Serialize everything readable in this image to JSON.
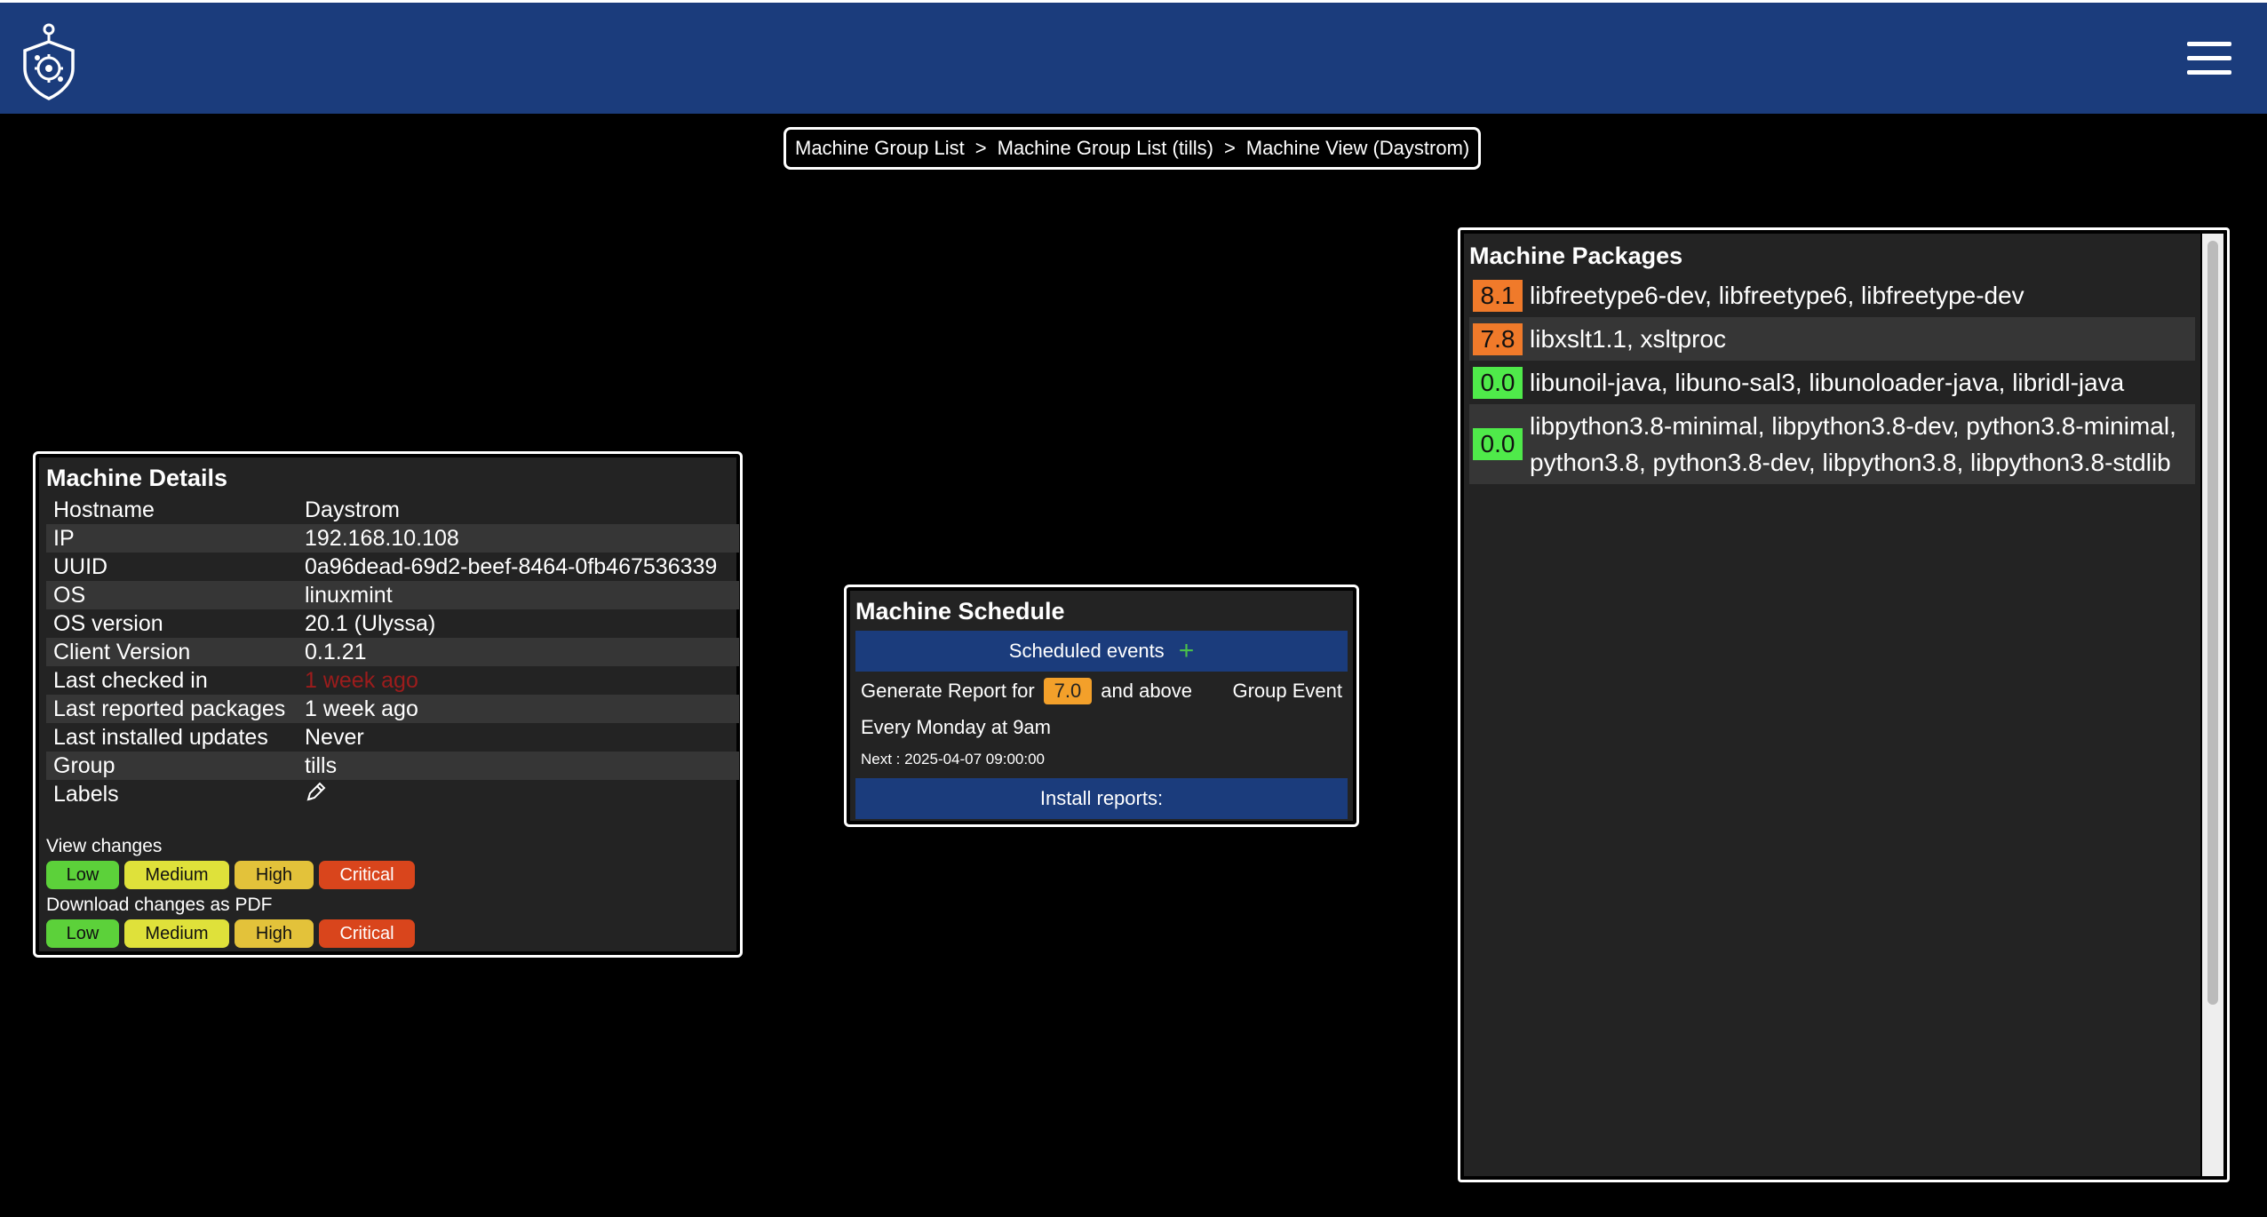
{
  "header": {
    "logo_icon": "shield-gear-icon",
    "menu_icon": "hamburger-menu-icon"
  },
  "breadcrumb": {
    "items": [
      "Machine Group List",
      "Machine Group List (tills)",
      "Machine View (Daystrom)"
    ],
    "separator": ">"
  },
  "machine_details": {
    "title": "Machine Details",
    "rows": [
      {
        "key": "Hostname",
        "value": "Daystrom"
      },
      {
        "key": "IP",
        "value": "192.168.10.108"
      },
      {
        "key": "UUID",
        "value": "0a96dead-69d2-beef-8464-0fb467536339"
      },
      {
        "key": "OS",
        "value": "linuxmint"
      },
      {
        "key": "OS version",
        "value": "20.1 (Ulyssa)"
      },
      {
        "key": "Client Version",
        "value": "0.1.21"
      },
      {
        "key": "Last checked in",
        "value": "1 week ago"
      },
      {
        "key": "Last reported packages",
        "value": "1 week ago"
      },
      {
        "key": "Last installed updates",
        "value": "Never"
      },
      {
        "key": "Group",
        "value": "tills"
      },
      {
        "key": "Labels",
        "value": ""
      }
    ],
    "view_changes_label": "View changes",
    "download_label": "Download changes as PDF",
    "severity": {
      "low": "Low",
      "medium": "Medium",
      "high": "High",
      "critical": "Critical"
    },
    "labels_icon": "pencil-edit-icon",
    "stale_color": "#9c1c1c"
  },
  "machine_schedule": {
    "title": "Machine Schedule",
    "scheduled_events_label": "Scheduled events",
    "add_icon": "plus-icon",
    "generate_prefix": "Generate Report for",
    "threshold": "7.0",
    "generate_suffix": "and above",
    "event_type": "Group Event",
    "recurrence": "Every Monday at 9am",
    "next_run": "Next : 2025-04-07 09:00:00",
    "install_reports_label": "Install reports:"
  },
  "machine_packages": {
    "title": "Machine Packages",
    "items": [
      {
        "score": "8.1",
        "names": "libfreetype6-dev, libfreetype6, libfreetype-dev"
      },
      {
        "score": "7.8",
        "names": "libxslt1.1, xsltproc"
      },
      {
        "score": "0.0",
        "names": "libunoil-java, libuno-sal3, libunoloader-java, libridl-java"
      },
      {
        "score": "0.0",
        "names": "libpython3.8-minimal, libpython3.8-dev, python3.8-minimal, python3.8, python3.8-dev, libpython3.8, libpython3.8-stdlib"
      }
    ]
  },
  "colors": {
    "header_bg": "#1b3c7c",
    "high_score": "#f07a2a",
    "low_score": "#4fea4a",
    "threshold": "#f3a02a",
    "severity_low": "#5cd13a",
    "severity_medium": "#dfe13a",
    "severity_high": "#e3c23a",
    "severity_critical": "#d9451c"
  }
}
